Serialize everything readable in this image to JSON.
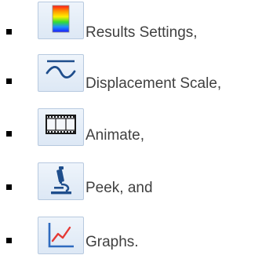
{
  "bullet_list": {
    "items": [
      {
        "icon": "results-settings-icon",
        "label": "Results Settings,"
      },
      {
        "icon": "displacement-scale-icon",
        "label": "Displacement Scale,"
      },
      {
        "icon": "animate-icon",
        "label": "Animate,"
      },
      {
        "icon": "peek-icon",
        "label": "Peek, and"
      },
      {
        "icon": "graphs-icon",
        "label": "Graphs."
      }
    ]
  },
  "colors": {
    "text": "#404040",
    "bullet": "#000000",
    "icon_background": "#dde8f5",
    "icon_border": "#b7c9df",
    "icon_stroke": "#1f4e8c",
    "graph_line": "#e53935",
    "graph_axis": "#2f6bbf"
  }
}
